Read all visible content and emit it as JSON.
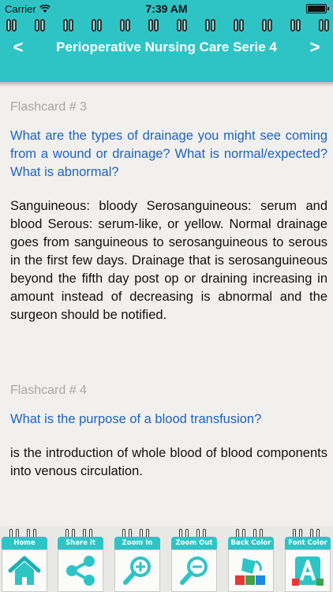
{
  "status_bar": {
    "carrier": "Carrier",
    "time": "7:39 AM"
  },
  "header": {
    "title": "Perioperative Nursing Care Serie 4",
    "prev_label": "<",
    "next_label": ">"
  },
  "cards": [
    {
      "label": "Flashcard # 3",
      "question": "What are the types of drainage you might see coming from a wound or drainage? What is normal/expected? What is abnormal?",
      "answer": "Sanguineous: bloody Serosanguineous: serum and blood Serous: serum-like, or yellow. Normal drainage goes from sanguineous to serosanguineous to serous in the first few days. Drainage that is serosanguineous beyond the fifth day post op or draining increasing in amount instead of decreasing is abnormal and the surgeon should be notified."
    },
    {
      "label": "Flashcard # 4",
      "question": "What is the purpose of a blood transfusion?",
      "answer": "is the introduction of whole blood of blood components into venous circulation."
    }
  ],
  "toolbar": {
    "items": [
      {
        "label": "Home",
        "icon": "home-icon"
      },
      {
        "label": "Share it",
        "icon": "share-icon"
      },
      {
        "label": "Zoom In",
        "icon": "zoom-in-icon"
      },
      {
        "label": "Zoom Out",
        "icon": "zoom-out-icon"
      },
      {
        "label": "Back Color",
        "icon": "paint-bucket-icon"
      },
      {
        "label": "Font Color",
        "icon": "font-color-icon"
      }
    ]
  },
  "colors": {
    "accent": "#2ec4c6",
    "question_text": "#1d62c4",
    "label_text": "#a7a7a7",
    "background": "#f1f0ed"
  }
}
